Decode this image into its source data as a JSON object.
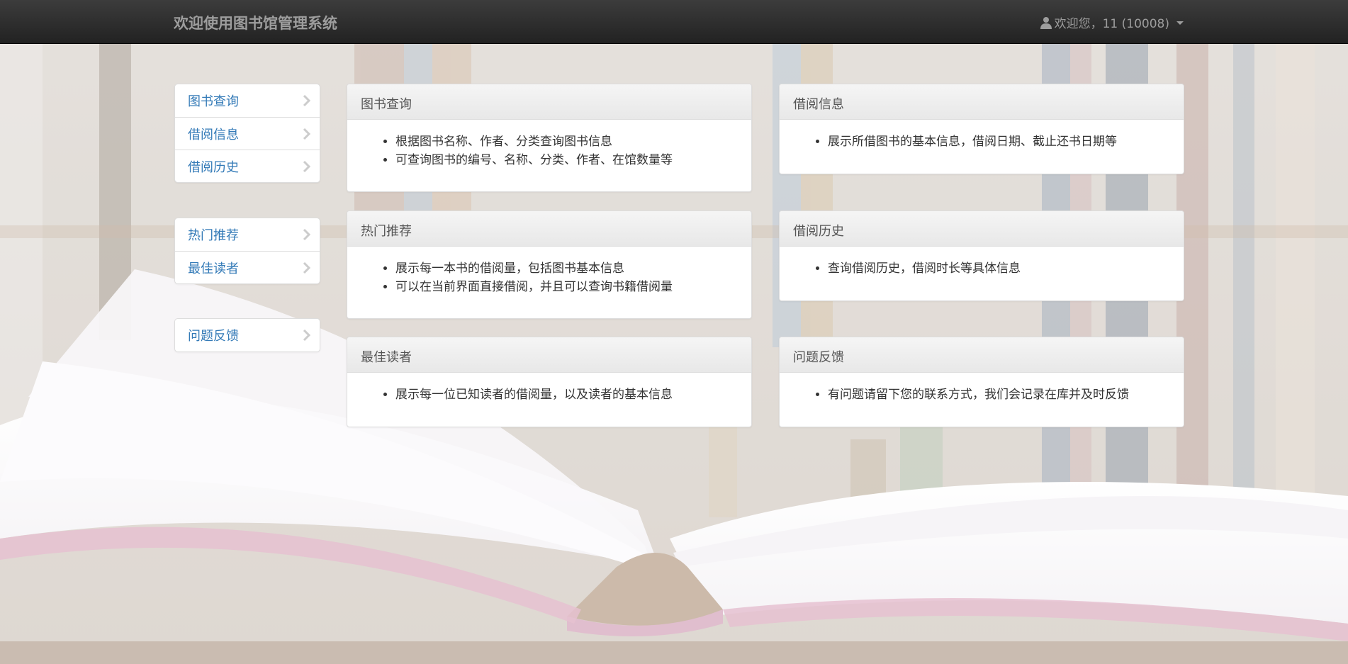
{
  "navbar": {
    "brand": "欢迎使用图书馆管理系统",
    "user_label": "欢迎您，11 (10008)",
    "user_icon": "user-icon"
  },
  "sidebar": {
    "groups": [
      {
        "items": [
          {
            "label": "图书查询"
          },
          {
            "label": "借阅信息"
          },
          {
            "label": "借阅历史"
          }
        ]
      },
      {
        "items": [
          {
            "label": "热门推荐"
          },
          {
            "label": "最佳读者"
          }
        ]
      },
      {
        "items": [
          {
            "label": "问题反馈"
          }
        ]
      }
    ]
  },
  "cards": [
    {
      "title": "图书查询",
      "bullets": [
        "根据图书名称、作者、分类查询图书信息",
        "可查询图书的编号、名称、分类、作者、在馆数量等"
      ]
    },
    {
      "title": "借阅信息",
      "bullets": [
        "展示所借图书的基本信息，借阅日期、截止还书日期等"
      ]
    },
    {
      "title": "热门推荐",
      "bullets": [
        "展示每一本书的借阅量，包括图书基本信息",
        "可以在当前界面直接借阅，并且可以查询书籍借阅量"
      ]
    },
    {
      "title": "借阅历史",
      "bullets": [
        "查询借阅历史，借阅时长等具体信息"
      ]
    },
    {
      "title": "最佳读者",
      "bullets": [
        "展示每一位已知读者的借阅量，以及读者的基本信息"
      ]
    },
    {
      "title": "问题反馈",
      "bullets": [
        "有问题请留下您的联系方式，我们会记录在库并及时反馈"
      ]
    }
  ],
  "colors": {
    "link": "#337ab7",
    "navbar": "#222222",
    "brand_text": "#9d9d9d"
  }
}
